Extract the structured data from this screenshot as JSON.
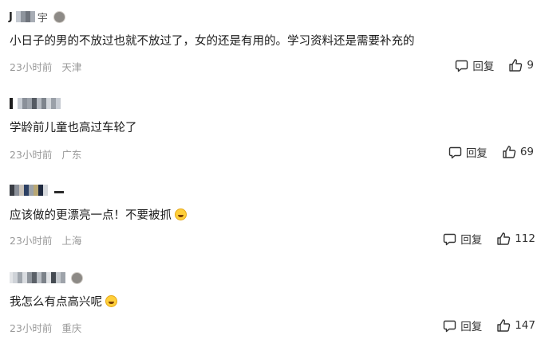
{
  "comments": [
    {
      "username": "J",
      "content": "小日子的男的不放过也就不放过了，女的还是有用的。学习资料还是需要补充的",
      "time": "23小时前",
      "location": "天津",
      "reply_label": "回复",
      "likes": "9",
      "emoji": "",
      "username_suffix": "宇"
    },
    {
      "username": "",
      "content": "学龄前儿童也高过车轮了",
      "time": "23小时前",
      "location": "广东",
      "reply_label": "回复",
      "likes": "69",
      "emoji": "",
      "username_suffix": ""
    },
    {
      "username": "",
      "content": "应该做的更漂亮一点！不要被抓",
      "time": "23小时前",
      "location": "上海",
      "reply_label": "回复",
      "likes": "112",
      "emoji": "grinning-face-emoji",
      "username_suffix": ""
    },
    {
      "username": "",
      "content": "我怎么有点高兴呢",
      "time": "23小时前",
      "location": "重庆",
      "reply_label": "回复",
      "likes": "147",
      "emoji": "laughing-face-emoji",
      "username_suffix": ""
    }
  ],
  "icons": {
    "reply": "comment-bubble-icon",
    "like": "thumbs-up-icon"
  },
  "colors": {
    "text": "#1a1a1a",
    "meta": "#999999",
    "emoji": "#ffcf3a"
  }
}
